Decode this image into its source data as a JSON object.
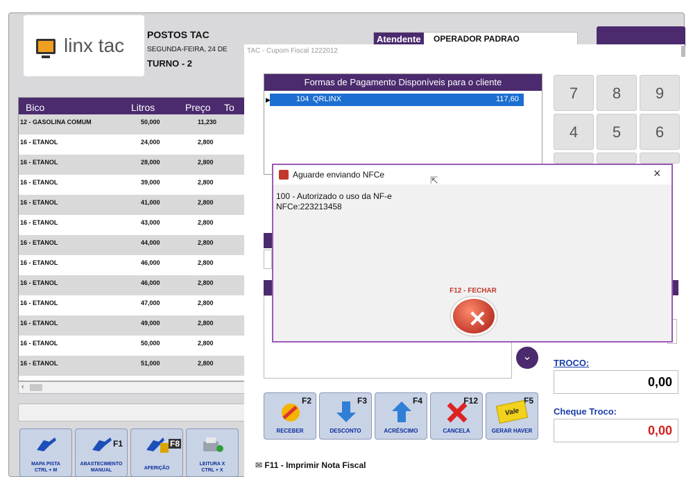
{
  "app": {
    "brand": "linx tac",
    "company": "POSTOS TAC",
    "date_line": "SEGUNDA-FEIRA, 24 DE",
    "turno": "TURNO - 2",
    "attendant_label": "Atendente",
    "attendant_value": "OPERADOR PADRAO"
  },
  "pump_table": {
    "headers": [
      "Bico",
      "Litros",
      "Preço",
      "To"
    ],
    "rows": [
      {
        "bico": "12 - GASOLINA COMUM",
        "litros": "50,000",
        "preco": "11,230"
      },
      {
        "bico": "16 - ETANOL",
        "litros": "24,000",
        "preco": "2,800"
      },
      {
        "bico": "16 - ETANOL",
        "litros": "28,000",
        "preco": "2,800"
      },
      {
        "bico": "16 - ETANOL",
        "litros": "39,000",
        "preco": "2,800"
      },
      {
        "bico": "16 - ETANOL",
        "litros": "41,000",
        "preco": "2,800"
      },
      {
        "bico": "16 - ETANOL",
        "litros": "43,000",
        "preco": "2,800"
      },
      {
        "bico": "16 - ETANOL",
        "litros": "44,000",
        "preco": "2,800"
      },
      {
        "bico": "16 - ETANOL",
        "litros": "46,000",
        "preco": "2,800"
      },
      {
        "bico": "16 - ETANOL",
        "litros": "46,000",
        "preco": "2,800"
      },
      {
        "bico": "16 - ETANOL",
        "litros": "47,000",
        "preco": "2,800"
      },
      {
        "bico": "16 - ETANOL",
        "litros": "49,000",
        "preco": "2,800"
      },
      {
        "bico": "16 - ETANOL",
        "litros": "50,000",
        "preco": "2,800"
      },
      {
        "bico": "16 - ETANOL",
        "litros": "51,000",
        "preco": "2,800"
      }
    ]
  },
  "bottom_buttons": [
    {
      "label": "MAPA PISTA",
      "shortcut": "CTRL + M"
    },
    {
      "label": "ABASTECIMENTO",
      "shortcut": "MANUAL",
      "key": "F1"
    },
    {
      "label": "AFERIÇÃO",
      "shortcut": "",
      "key": "F8"
    },
    {
      "label": "LEITURA X",
      "shortcut": "CTRL + X"
    }
  ],
  "cupom_window": {
    "title": "TAC - Cupom Fiscal 1222012",
    "payment_header": "Formas de Pagamento Disponíveis para o cliente",
    "payment_row": {
      "code": "104",
      "name": "QRLINX",
      "value": "117,60"
    },
    "keypad": [
      "7",
      "8",
      "9",
      "4",
      "5",
      "6"
    ],
    "troco_label": "TROCO:",
    "troco_value": "0,00",
    "cheque_label": "Cheque Troco:",
    "cheque_value": "0,00",
    "print_label": "F11 - Imprimir Nota Fiscal",
    "fbuttons": [
      {
        "key": "F2",
        "label": "RECEBER"
      },
      {
        "key": "F3",
        "label": "DESCONTO"
      },
      {
        "key": "F4",
        "label": "ACRÉSCIMO"
      },
      {
        "key": "F12",
        "label": "CANCELA"
      },
      {
        "key": "F5",
        "label": "GERAR HAVER",
        "icon_text": "Vale"
      }
    ]
  },
  "dialog": {
    "title": "Aguarde enviando NFCe",
    "close": "×",
    "line1": "100 - Autorizado o uso da NF-e",
    "line2": "NFCe:223213458",
    "close_button": "F12 - FECHAR"
  }
}
